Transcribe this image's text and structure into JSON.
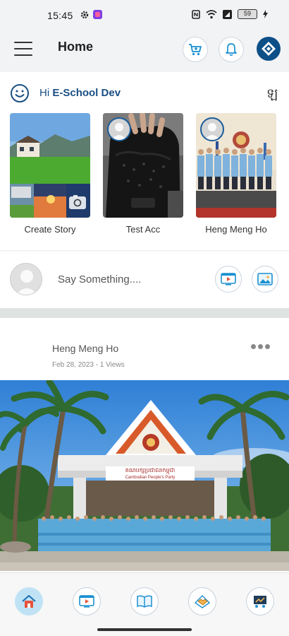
{
  "status_bar": {
    "time": "15:45",
    "battery": "59"
  },
  "header": {
    "title": "Home"
  },
  "greeting": {
    "prefix": "Hi ",
    "name": "E-School Dev",
    "language_glyph": "ឡ"
  },
  "stories": [
    {
      "label": "Create Story"
    },
    {
      "label": "Test Acc"
    },
    {
      "label": "Heng Meng Ho"
    }
  ],
  "composer": {
    "placeholder": "Say Something...."
  },
  "post": {
    "author": "Heng Meng Ho",
    "meta": "Feb 28, 2023 - 1 Views",
    "banner_text": "គណបក្សប្រជាជនកម្ពុជា",
    "banner_subtext": "Cambodian People's Party"
  },
  "colors": {
    "brand": "#0e4f87",
    "accent": "#1a5d9a",
    "active_nav": "#bfe3f5"
  },
  "bottom_nav": [
    {
      "name": "home-icon"
    },
    {
      "name": "video-icon"
    },
    {
      "name": "book-icon"
    },
    {
      "name": "handshake-icon"
    },
    {
      "name": "presentation-icon"
    }
  ]
}
